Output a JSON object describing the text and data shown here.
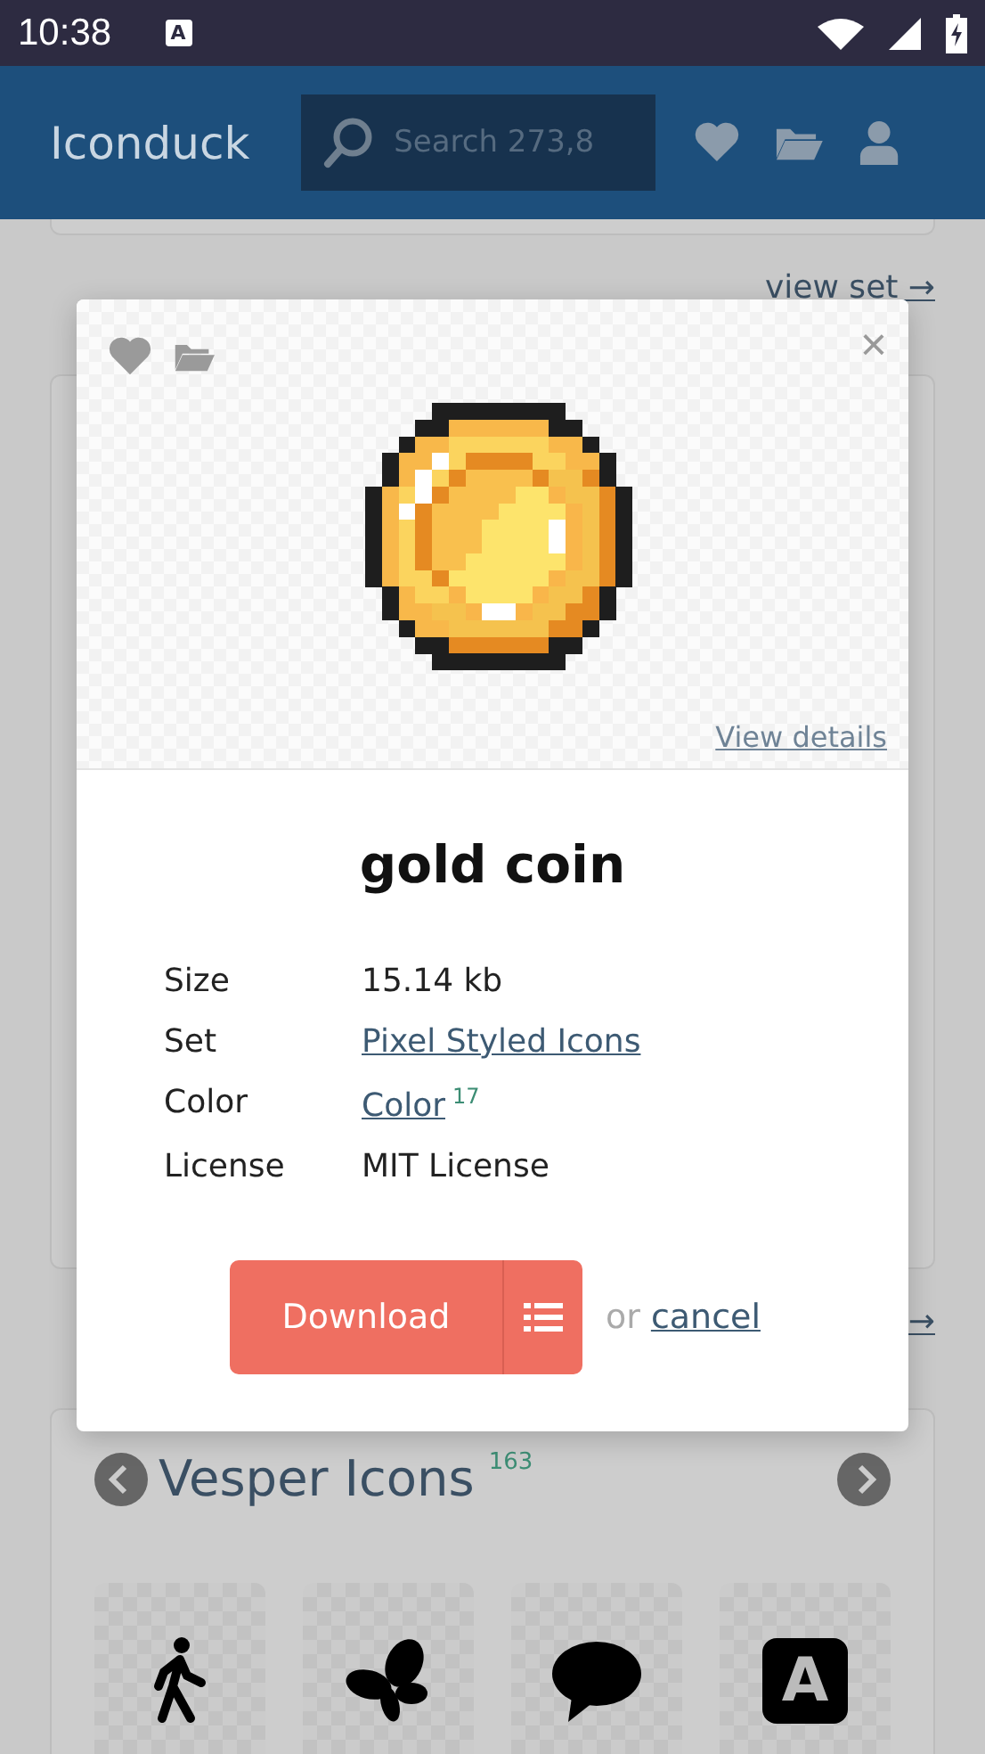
{
  "status_bar": {
    "time": "10:38",
    "notification_glyph": "A"
  },
  "header": {
    "logo": "Iconduck",
    "search": {
      "placeholder": "Search 273,8"
    }
  },
  "background": {
    "link_top": "view set →",
    "link_bottom": "→"
  },
  "set_card": {
    "title": "Vesper Icons",
    "count": "163",
    "tiles": [
      {
        "kind": "walking"
      },
      {
        "kind": "butterfly"
      },
      {
        "kind": "speech"
      },
      {
        "kind": "letter",
        "glyph": "A"
      }
    ]
  },
  "modal": {
    "close": "×",
    "view_details": "View details",
    "title": "gold coin",
    "details": [
      {
        "label": "Size",
        "value": "15.14 kb",
        "link": false
      },
      {
        "label": "Set",
        "value": "Pixel Styled Icons",
        "link": true
      },
      {
        "label": "Color",
        "value": "Color",
        "link": true,
        "count": "17"
      },
      {
        "label": "License",
        "value": "MIT License",
        "link": false
      }
    ],
    "download": "Download",
    "or": "or",
    "cancel": "cancel"
  }
}
